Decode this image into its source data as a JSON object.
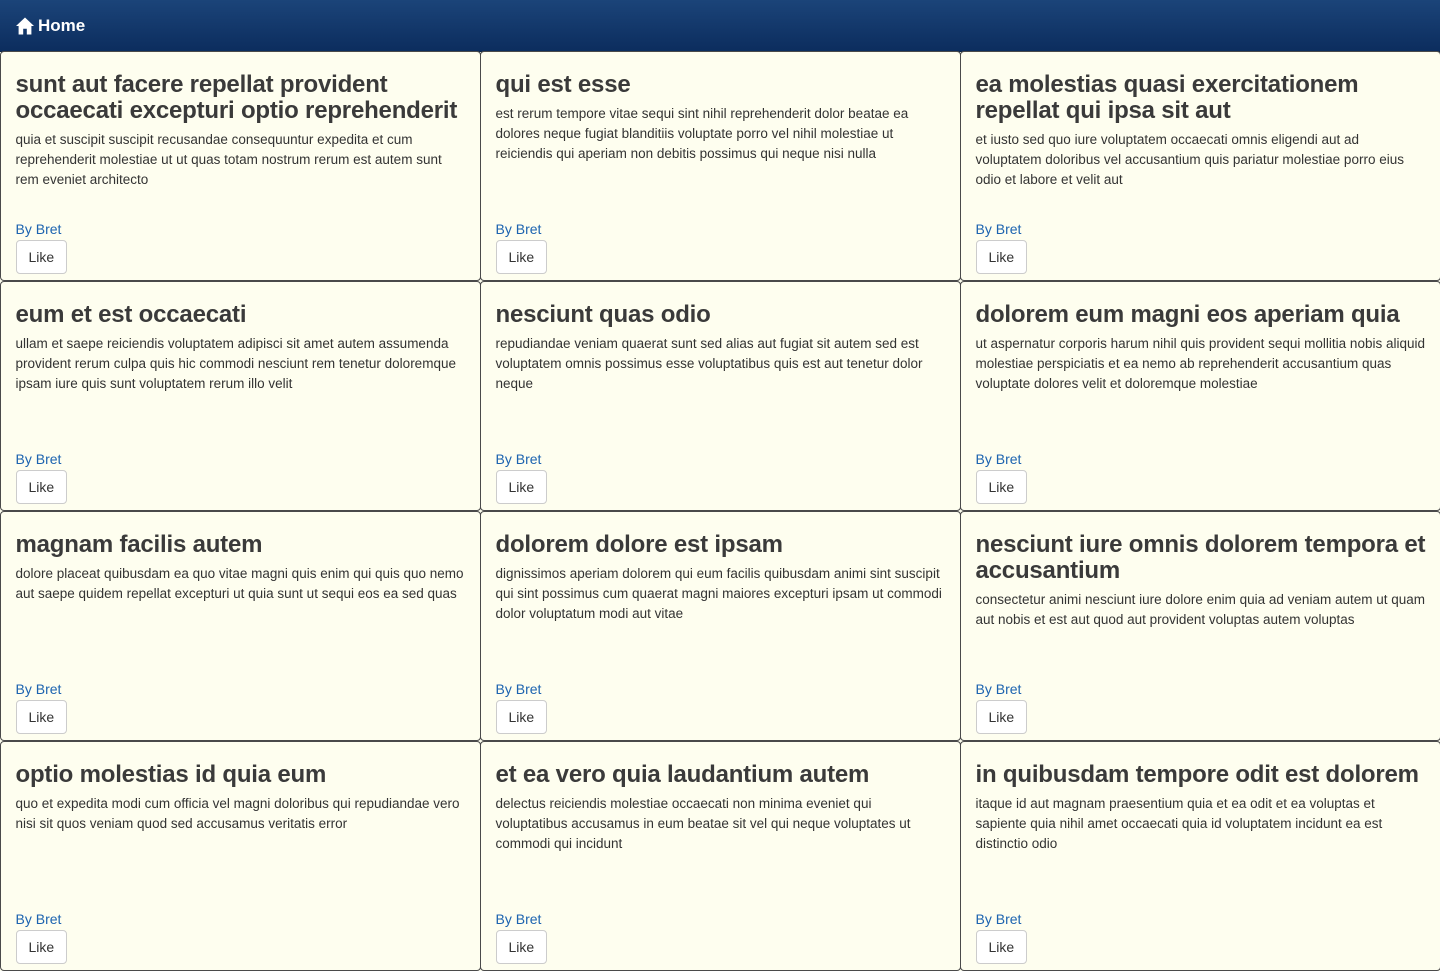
{
  "nav": {
    "home_label": "Home",
    "home_icon": "home-icon"
  },
  "author_label": "By Bret",
  "like_label": "Like",
  "posts": [
    {
      "title": "sunt aut facere repellat provident occaecati excepturi optio reprehenderit",
      "body": "quia et suscipit suscipit recusandae consequuntur expedita et cum reprehenderit molestiae ut ut quas totam nostrum rerum est autem sunt rem eveniet architecto"
    },
    {
      "title": "qui est esse",
      "body": "est rerum tempore vitae sequi sint nihil reprehenderit dolor beatae ea dolores neque fugiat blanditiis voluptate porro vel nihil molestiae ut reiciendis qui aperiam non debitis possimus qui neque nisi nulla"
    },
    {
      "title": "ea molestias quasi exercitationem repellat qui ipsa sit aut",
      "body": "et iusto sed quo iure voluptatem occaecati omnis eligendi aut ad voluptatem doloribus vel accusantium quis pariatur molestiae porro eius odio et labore et velit aut"
    },
    {
      "title": "eum et est occaecati",
      "body": "ullam et saepe reiciendis voluptatem adipisci sit amet autem assumenda provident rerum culpa quis hic commodi nesciunt rem tenetur doloremque ipsam iure quis sunt voluptatem rerum illo velit"
    },
    {
      "title": "nesciunt quas odio",
      "body": "repudiandae veniam quaerat sunt sed alias aut fugiat sit autem sed est voluptatem omnis possimus esse voluptatibus quis est aut tenetur dolor neque"
    },
    {
      "title": "dolorem eum magni eos aperiam quia",
      "body": "ut aspernatur corporis harum nihil quis provident sequi mollitia nobis aliquid molestiae perspiciatis et ea nemo ab reprehenderit accusantium quas voluptate dolores velit et doloremque molestiae"
    },
    {
      "title": "magnam facilis autem",
      "body": "dolore placeat quibusdam ea quo vitae magni quis enim qui quis quo nemo aut saepe quidem repellat excepturi ut quia sunt ut sequi eos ea sed quas"
    },
    {
      "title": "dolorem dolore est ipsam",
      "body": "dignissimos aperiam dolorem qui eum facilis quibusdam animi sint suscipit qui sint possimus cum quaerat magni maiores excepturi ipsam ut commodi dolor voluptatum modi aut vitae"
    },
    {
      "title": "nesciunt iure omnis dolorem tempora et accusantium",
      "body": "consectetur animi nesciunt iure dolore enim quia ad veniam autem ut quam aut nobis et est aut quod aut provident voluptas autem voluptas"
    },
    {
      "title": "optio molestias id quia eum",
      "body": "quo et expedita modi cum officia vel magni doloribus qui repudiandae vero nisi sit quos veniam quod sed accusamus veritatis error"
    },
    {
      "title": "et ea vero quia laudantium autem",
      "body": "delectus reiciendis molestiae occaecati non minima eveniet qui voluptatibus accusamus in eum beatae sit vel qui neque voluptates ut commodi qui incidunt"
    },
    {
      "title": "in quibusdam tempore odit est dolorem",
      "body": "itaque id aut magnam praesentium quia et ea odit et ea voluptas et sapiente quia nihil amet occaecati quia id voluptatem incidunt ea est distinctio odio"
    }
  ]
}
